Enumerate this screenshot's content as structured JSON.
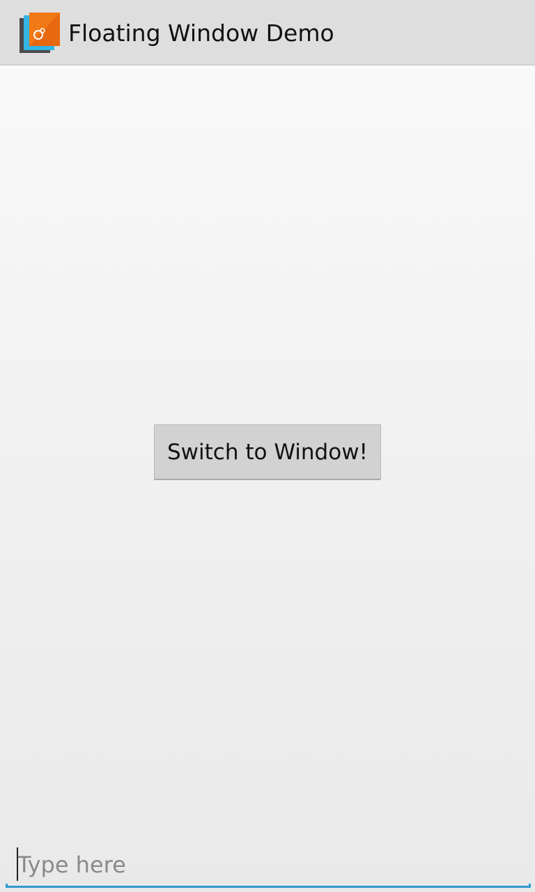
{
  "action_bar": {
    "title": "Floating Window Demo",
    "icon": "floating-window-app-icon"
  },
  "main": {
    "switch_button_label": "Switch to Window!"
  },
  "edit_text": {
    "placeholder": "Type here",
    "value": ""
  },
  "colors": {
    "accent": "#2e9bd0",
    "icon_orange": "#f07a16",
    "icon_blue": "#33b5e5"
  }
}
